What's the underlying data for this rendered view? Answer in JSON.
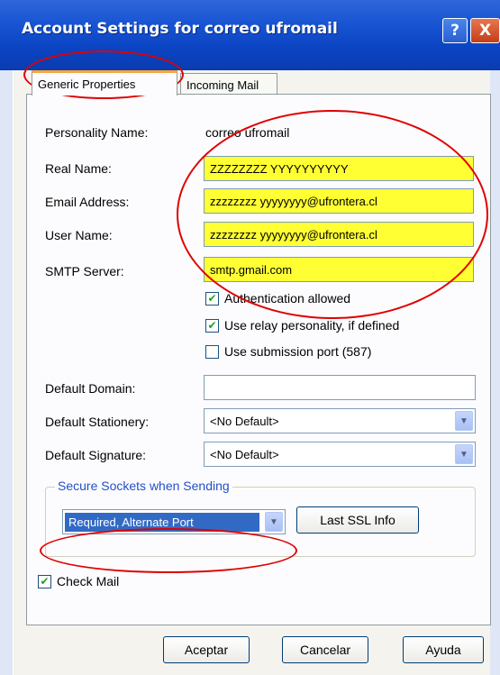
{
  "window": {
    "title": "Account Settings for correo ufromail",
    "help_glyph": "?",
    "close_glyph": "X"
  },
  "tabs": [
    {
      "label": "Generic Properties"
    },
    {
      "label": "Incoming Mail"
    }
  ],
  "form": {
    "personality_label": "Personality Name:",
    "personality_value": "correo ufromail",
    "real_name_label": "Real Name:",
    "real_name_value": "ZZZZZZZZ YYYYYYYYYY",
    "email_label": "Email Address:",
    "email_value": "zzzzzzzz yyyyyyyy@ufrontera.cl",
    "user_label": "User Name:",
    "user_value": "zzzzzzzz yyyyyyyy@ufrontera.cl",
    "smtp_label": "SMTP Server:",
    "smtp_value": "smtp.gmail.com",
    "auth_label": "Authentication allowed",
    "relay_label": "Use relay personality, if defined",
    "submission_label": "Use submission port (587)",
    "domain_label": "Default Domain:",
    "domain_value": "",
    "stationery_label": "Default Stationery:",
    "stationery_value": "<No Default>",
    "signature_label": "Default Signature:",
    "signature_value": "<No Default>",
    "secure_group_title": "Secure Sockets when Sending",
    "secure_value": "Required, Alternate Port",
    "last_ssl_label": "Last SSL Info",
    "check_mail_label": "Check Mail"
  },
  "checks": {
    "auth": true,
    "relay": true,
    "submission": false,
    "check_mail": true
  },
  "buttons": {
    "ok": "Aceptar",
    "cancel": "Cancelar",
    "help": "Ayuda"
  },
  "colors": {
    "highlight": "#ffff33",
    "annotation": "#e00000",
    "selection": "#316ac5"
  }
}
